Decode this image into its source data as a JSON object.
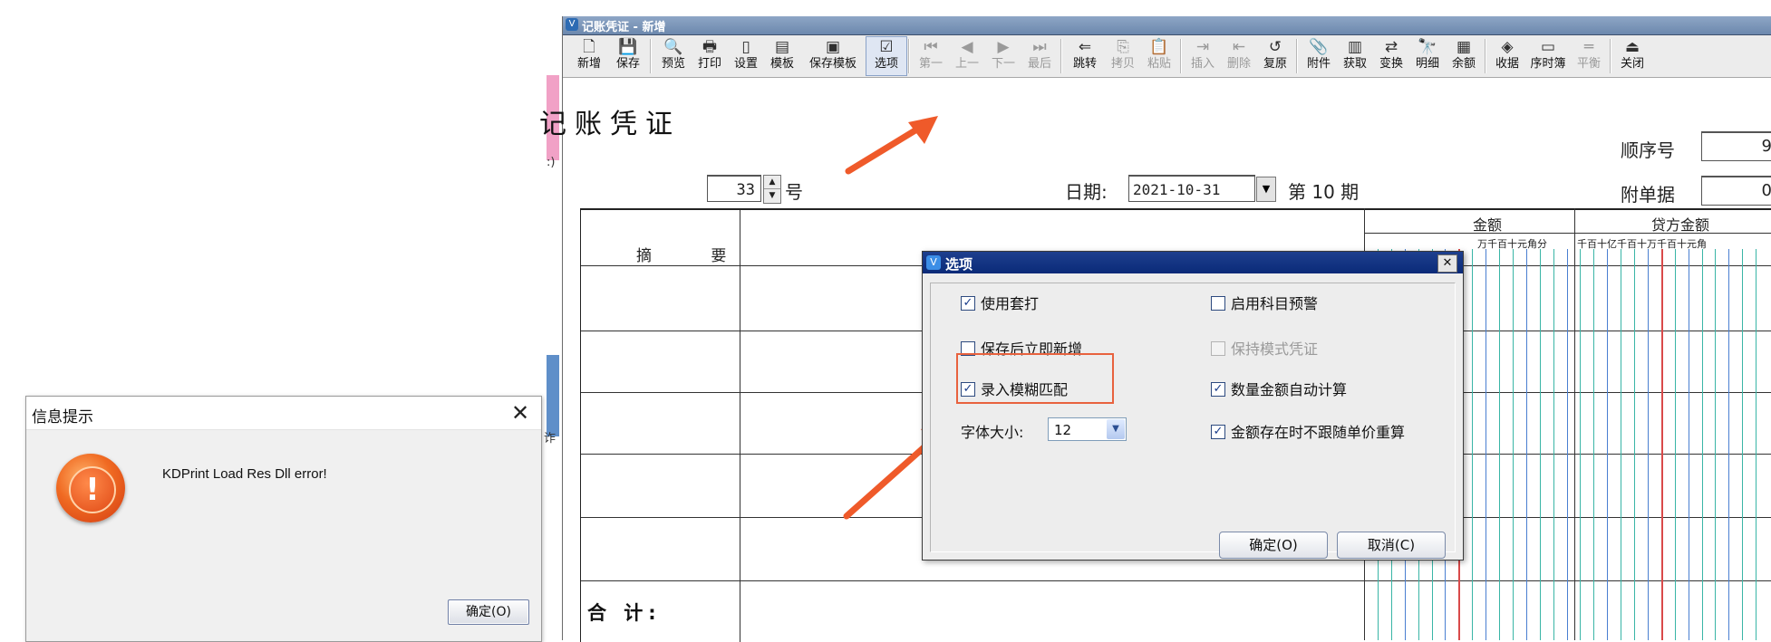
{
  "info_dialog": {
    "title": "信息提示",
    "close_glyph": "✕",
    "icon": "error-exclamation-icon",
    "icon_glyph": "!",
    "message": "KDPrint Load  Res Dll error!",
    "ok_label": "确定(O)"
  },
  "scraps": {
    "text1": ":)",
    "text2": "诈"
  },
  "main_window": {
    "title": "记账凭证 - 新增",
    "title_icon_glyph": "V"
  },
  "toolbar": {
    "buttons": [
      {
        "label": "新增",
        "icon": "new-file-icon",
        "glyph": "🗋"
      },
      {
        "label": "保存",
        "icon": "save-icon",
        "glyph": "💾"
      },
      {
        "label": "预览",
        "icon": "preview-icon",
        "glyph": "🔍"
      },
      {
        "label": "打印",
        "icon": "print-icon",
        "glyph": "🖶"
      },
      {
        "label": "设置",
        "icon": "page-setup-icon",
        "glyph": "▯"
      },
      {
        "label": "模板",
        "icon": "template-icon",
        "glyph": "▤"
      },
      {
        "label": "保存模板",
        "icon": "save-template-icon",
        "glyph": "▣"
      },
      {
        "label": "选项",
        "icon": "options-icon",
        "glyph": "☑"
      },
      {
        "label": "第一",
        "icon": "first-icon",
        "glyph": "⏮"
      },
      {
        "label": "上一",
        "icon": "previous-icon",
        "glyph": "◀"
      },
      {
        "label": "下一",
        "icon": "next-icon",
        "glyph": "▶"
      },
      {
        "label": "最后",
        "icon": "last-icon",
        "glyph": "⏭"
      },
      {
        "label": "跳转",
        "icon": "jump-icon",
        "glyph": "⇐"
      },
      {
        "label": "拷贝",
        "icon": "copy-icon",
        "glyph": "⎘"
      },
      {
        "label": "粘贴",
        "icon": "paste-icon",
        "glyph": "📋"
      },
      {
        "label": "插入",
        "icon": "insert-row-icon",
        "glyph": "⇥"
      },
      {
        "label": "删除",
        "icon": "delete-row-icon",
        "glyph": "⇤"
      },
      {
        "label": "复原",
        "icon": "restore-icon",
        "glyph": "↺"
      },
      {
        "label": "附件",
        "icon": "attachment-icon",
        "glyph": "📎"
      },
      {
        "label": "获取",
        "icon": "fetch-icon",
        "glyph": "▥"
      },
      {
        "label": "变换",
        "icon": "transform-icon",
        "glyph": "⇄"
      },
      {
        "label": "明细",
        "icon": "detail-icon",
        "glyph": "🔭"
      },
      {
        "label": "余额",
        "icon": "balance-icon",
        "glyph": "▦"
      },
      {
        "label": "收据",
        "icon": "receipt-icon",
        "glyph": "◈"
      },
      {
        "label": "序时簿",
        "icon": "journal-icon",
        "glyph": "▭"
      },
      {
        "label": "平衡",
        "icon": "balance-check-icon",
        "glyph": "═"
      },
      {
        "label": "关闭",
        "icon": "close-window-icon",
        "glyph": "⏏"
      }
    ]
  },
  "voucher": {
    "heading": "记账凭证",
    "sequence_label": "顺序号",
    "sequence_value": "9",
    "attachments_label": "附单据",
    "attachments_value": "0",
    "number_value": "33",
    "number_suffix": "号",
    "date_label": "日期:",
    "date_value": "2021-10-31",
    "period_text": "第 10 期",
    "summary_header": "摘 要",
    "debit_header": "金额",
    "credit_header": "贷方金额",
    "debit_digits": "万千百十元角分",
    "credit_digits": "千百十亿千百十万千百十元角",
    "total_label": "合 计:"
  },
  "options_dialog": {
    "title": "选项",
    "title_icon_glyph": "V",
    "close_glyph": "✕",
    "options": [
      {
        "label": "使用套打",
        "checked": true,
        "disabled": false
      },
      {
        "label": "启用科目预警",
        "checked": false,
        "disabled": false
      },
      {
        "label": "保存后立即新增",
        "checked": false,
        "disabled": false
      },
      {
        "label": "保持模式凭证",
        "checked": false,
        "disabled": true
      },
      {
        "label": "录入模糊匹配",
        "checked": true,
        "disabled": false
      },
      {
        "label": "数量金额自动计算",
        "checked": true,
        "disabled": false
      },
      {
        "label": "金额存在时不跟随单价重算",
        "checked": true,
        "disabled": false
      }
    ],
    "font_size_label": "字体大小:",
    "font_size_value": "12",
    "ok_label": "确定(O)",
    "cancel_label": "取消(C)"
  },
  "colors": {
    "highlight": "#e8623e",
    "arrow": "#ef5a2a",
    "dialog_title": "#0a2a78"
  }
}
